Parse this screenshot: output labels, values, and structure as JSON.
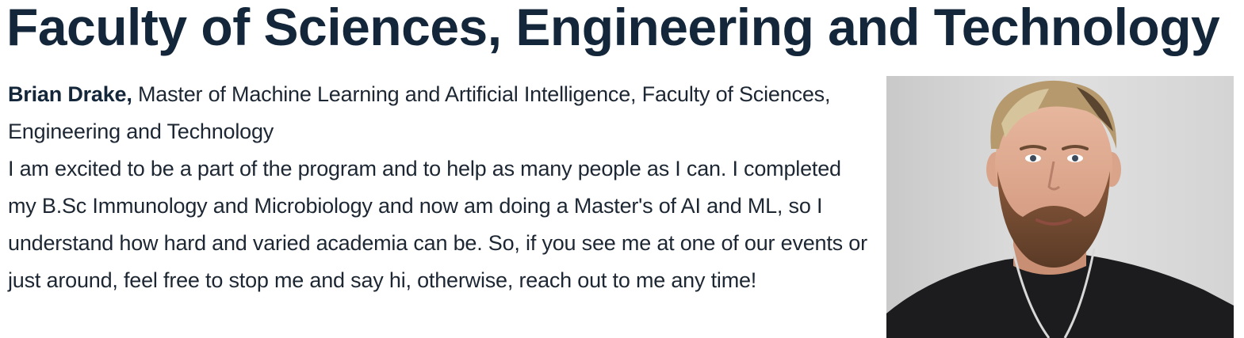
{
  "heading": "Faculty of Sciences, Engineering and Technology",
  "profile": {
    "name": "Brian Drake,",
    "role": "Master of Machine Learning and Artificial Intelligence, Faculty of Sciences, Engineering and Technology",
    "bio": "I am excited to be a part of the program and to help as many people as I can. I completed my B.Sc Immunology and Microbiology and now am doing a Master's of AI and ML, so I understand how hard and varied academia can be. So, if you see me at one of our events or just around, feel free to stop me and say hi, otherwise, reach out to me any time!"
  },
  "colors": {
    "heading": "#13263a",
    "text": "#1d2733",
    "background": "#ffffff"
  }
}
